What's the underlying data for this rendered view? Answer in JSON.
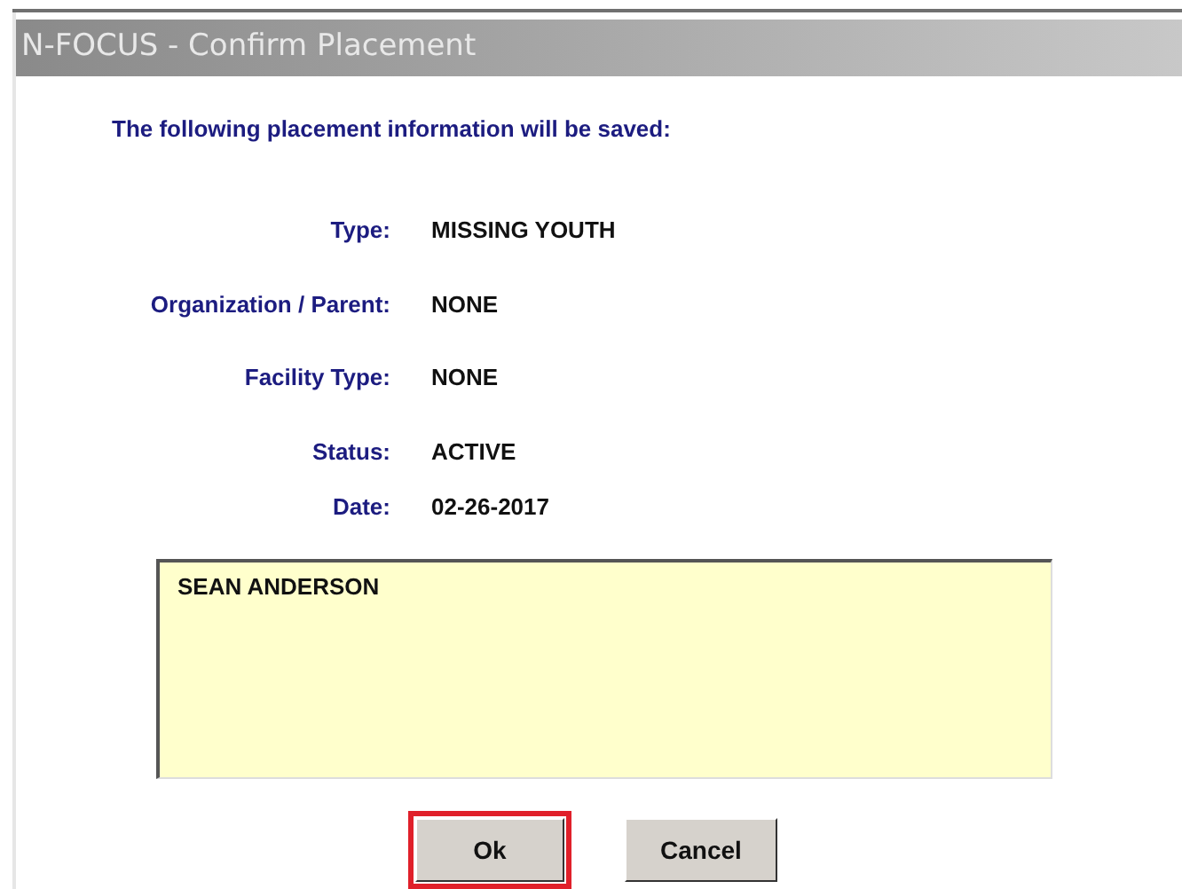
{
  "window": {
    "title": "N-FOCUS - Confirm Placement"
  },
  "heading": "The following placement information will be saved:",
  "fields": [
    {
      "label": "Type:",
      "value": "MISSING YOUTH"
    },
    {
      "label": "Organization / Parent:",
      "value": "NONE"
    },
    {
      "label": "Facility Type:",
      "value": "NONE"
    },
    {
      "label": "Status:",
      "value": "ACTIVE"
    },
    {
      "label": "Date:",
      "value": "02-26-2017"
    }
  ],
  "notes": {
    "value": "SEAN ANDERSON"
  },
  "buttons": [
    {
      "label": "Ok",
      "highlighted": true
    },
    {
      "label": "Cancel",
      "highlighted": false
    }
  ]
}
